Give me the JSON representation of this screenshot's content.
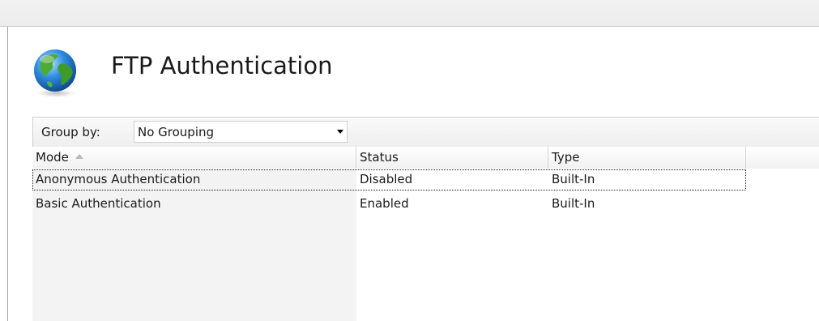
{
  "page": {
    "title": "FTP Authentication",
    "icon": "globe-icon"
  },
  "groupbar": {
    "label": "Group by:",
    "selected": "No Grouping"
  },
  "table": {
    "columns": [
      {
        "label": "Mode",
        "sorted": "ascending"
      },
      {
        "label": "Status"
      },
      {
        "label": "Type"
      },
      {
        "label": ""
      }
    ],
    "rows": [
      {
        "mode": "Anonymous Authentication",
        "status": "Disabled",
        "type": "Built-In",
        "selected": true
      },
      {
        "mode": "Basic Authentication",
        "status": "Enabled",
        "type": "Built-In",
        "selected": false
      }
    ]
  },
  "colors": {
    "header_bg": "#f2f2f2",
    "first_column_bg": "#f3f3f3",
    "border": "#d5d5d5"
  }
}
